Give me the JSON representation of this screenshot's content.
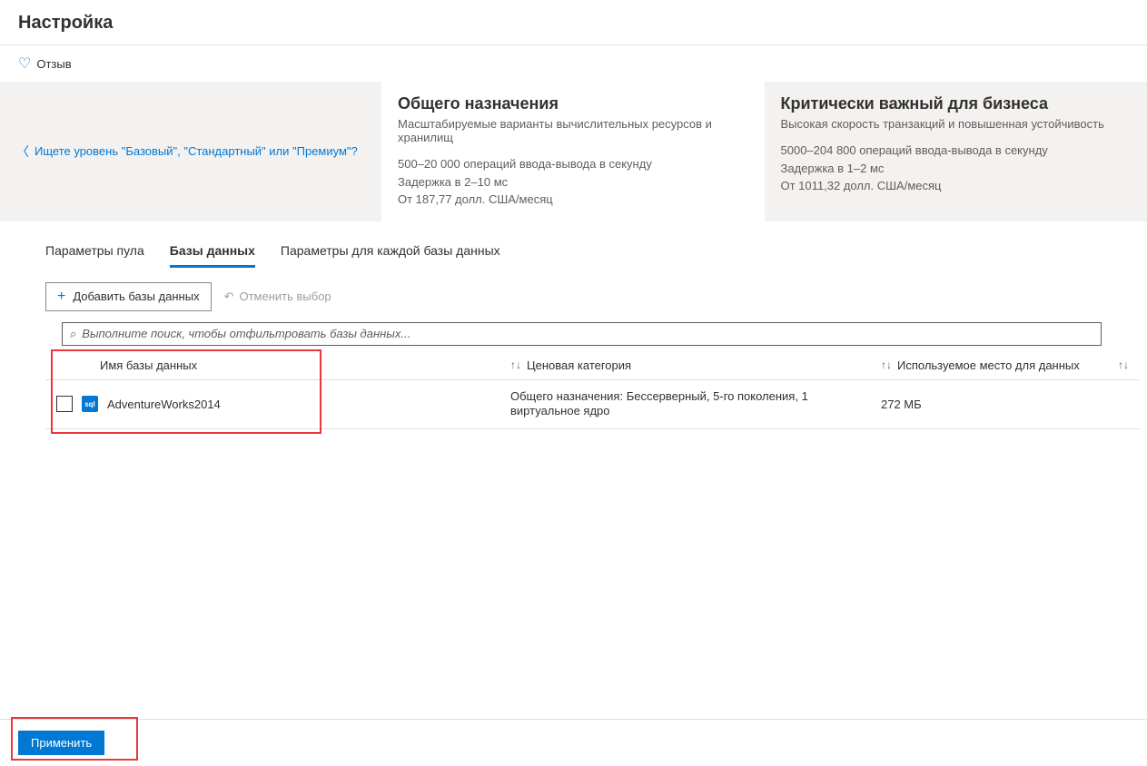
{
  "header": {
    "title": "Настройка"
  },
  "feedback": {
    "label": "Отзыв"
  },
  "tierLink": {
    "text": "Ищете уровень \"Базовый\", \"Стандартный\" или \"Премиум\"?"
  },
  "tiers": {
    "general": {
      "title": "Общего назначения",
      "subtitle": "Масштабируемые варианты вычислительных ресурсов и хранилищ",
      "line1": "500–20 000 операций ввода-вывода в секунду",
      "line2": "Задержка в 2–10 мс",
      "line3": "От 187,77 долл. США/месяц"
    },
    "critical": {
      "title": "Критически важный для бизнеса",
      "subtitle": "Высокая скорость транзакций и повышенная устойчивость",
      "line1": "5000–204 800 операций ввода-вывода в секунду",
      "line2": "Задержка в 1–2 мс",
      "line3": "От 1011,32 долл. США/месяц"
    }
  },
  "tabs": {
    "pool": "Параметры пула",
    "databases": "Базы данных",
    "perDb": "Параметры для каждой базы данных"
  },
  "toolbar": {
    "addLabel": "Добавить базы данных",
    "resetLabel": "Отменить выбор"
  },
  "search": {
    "placeholder": "Выполните поиск, чтобы отфильтровать базы данных..."
  },
  "columns": {
    "name": "Имя базы данных",
    "tier": "Ценовая категория",
    "space": "Используемое место для данных"
  },
  "rows": [
    {
      "name": "AdventureWorks2014",
      "tier": "Общего назначения: Бессерверный, 5-го поколения, 1 виртуальное ядро",
      "space": "272 МБ"
    }
  ],
  "footer": {
    "apply": "Применить"
  }
}
